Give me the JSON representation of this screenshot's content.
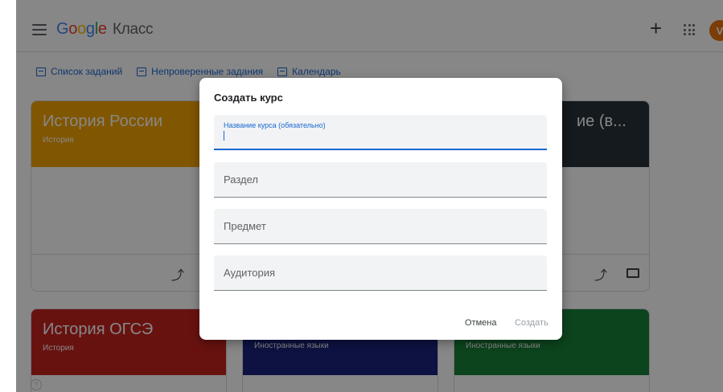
{
  "header": {
    "logo_letters": [
      "G",
      "o",
      "o",
      "g",
      "l",
      "e"
    ],
    "product": "Класс",
    "plus_label": "+",
    "avatar_letter": "V"
  },
  "nav": {
    "items": [
      {
        "label": "Список заданий"
      },
      {
        "label": "Непроверенные задания"
      },
      {
        "label": "Календарь"
      }
    ]
  },
  "cards": [
    {
      "title": "История России",
      "subtitle": "История",
      "color": "#f4a300"
    },
    {
      "title": "ие (в...",
      "subtitle": "",
      "color": "#263238"
    },
    {
      "title": "История ОГСЭ",
      "subtitle": "История",
      "color": "#c5221f"
    },
    {
      "title": "",
      "subtitle": "Иностранные языки",
      "color": "#1a237e"
    },
    {
      "title": "",
      "subtitle": "Иностранные языки",
      "color": "#188038"
    }
  ],
  "dialog": {
    "title": "Создать курс",
    "fields": [
      {
        "label": "Название курса (обязательно)",
        "active": true
      },
      {
        "label": "Раздел"
      },
      {
        "label": "Предмет"
      },
      {
        "label": "Аудитория"
      }
    ],
    "cancel_label": "Отмена",
    "create_label": "Создать"
  },
  "colors": {
    "accent": "#1967d2"
  }
}
